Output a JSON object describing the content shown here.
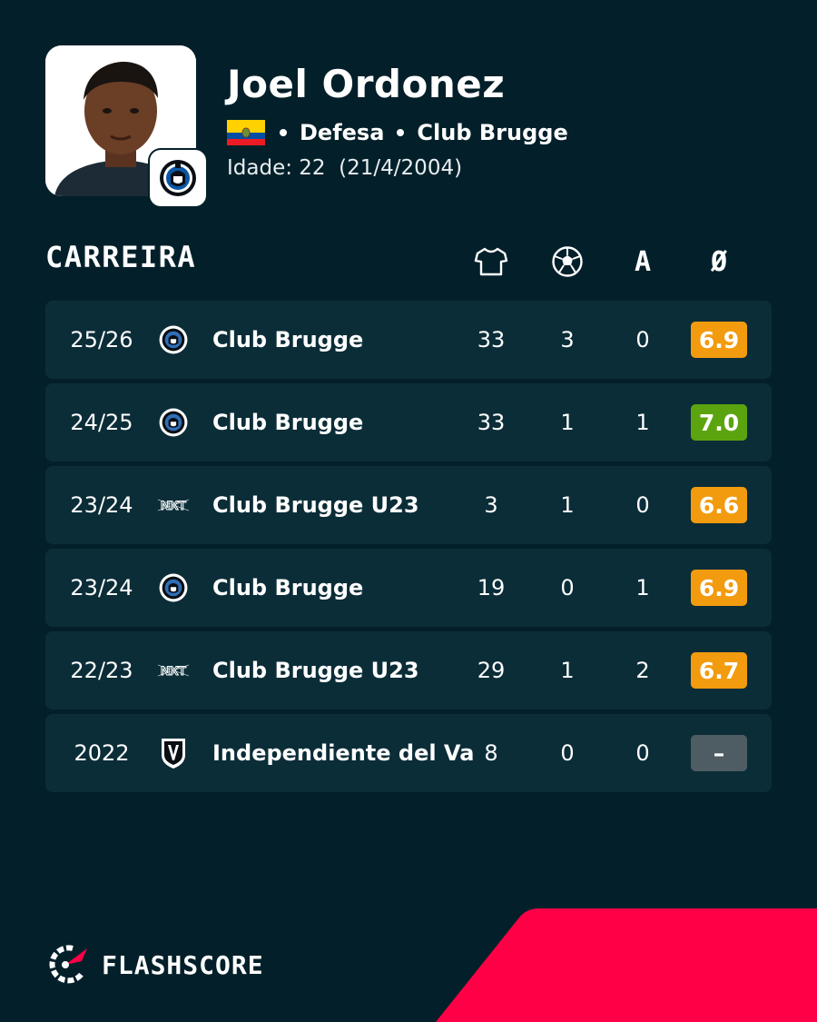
{
  "player": {
    "name": "Joel Ordonez",
    "position": "Defesa",
    "club": "Club Brugge",
    "age_line": "Idade: 22  (21/4/2004)",
    "nationality_flag": "ecuador-flag-icon"
  },
  "career": {
    "title": "CARREIRA",
    "columns": {
      "apps_icon": "shirt-icon",
      "goals_icon": "football-icon",
      "assists_label": "A",
      "rating_label": "Ø"
    },
    "rows": [
      {
        "season": "25/26",
        "club": "Club Brugge",
        "logo": "club-brugge-logo",
        "apps": "33",
        "goals": "3",
        "assists": "0",
        "rating": "6.9",
        "rating_color": "#f29b0e"
      },
      {
        "season": "24/25",
        "club": "Club Brugge",
        "logo": "club-brugge-logo",
        "apps": "33",
        "goals": "1",
        "assists": "1",
        "rating": "7.0",
        "rating_color": "#5ba40f"
      },
      {
        "season": "23/24",
        "club": "Club Brugge U23",
        "logo": "club-nxt-logo",
        "apps": "3",
        "goals": "1",
        "assists": "0",
        "rating": "6.6",
        "rating_color": "#f29b0e"
      },
      {
        "season": "23/24",
        "club": "Club Brugge",
        "logo": "club-brugge-logo",
        "apps": "19",
        "goals": "0",
        "assists": "1",
        "rating": "6.9",
        "rating_color": "#f29b0e"
      },
      {
        "season": "22/23",
        "club": "Club Brugge U23",
        "logo": "club-nxt-logo",
        "apps": "29",
        "goals": "1",
        "assists": "2",
        "rating": "6.7",
        "rating_color": "#f29b0e"
      },
      {
        "season": "2022",
        "club": "Independiente del Va",
        "logo": "independiente-del-valle-logo",
        "apps": "8",
        "goals": "0",
        "assists": "0",
        "rating": "–",
        "rating_color": "#4e5d63"
      }
    ]
  },
  "brand": {
    "name": "FLASHSCORE",
    "accent_color": "#ff0046"
  }
}
